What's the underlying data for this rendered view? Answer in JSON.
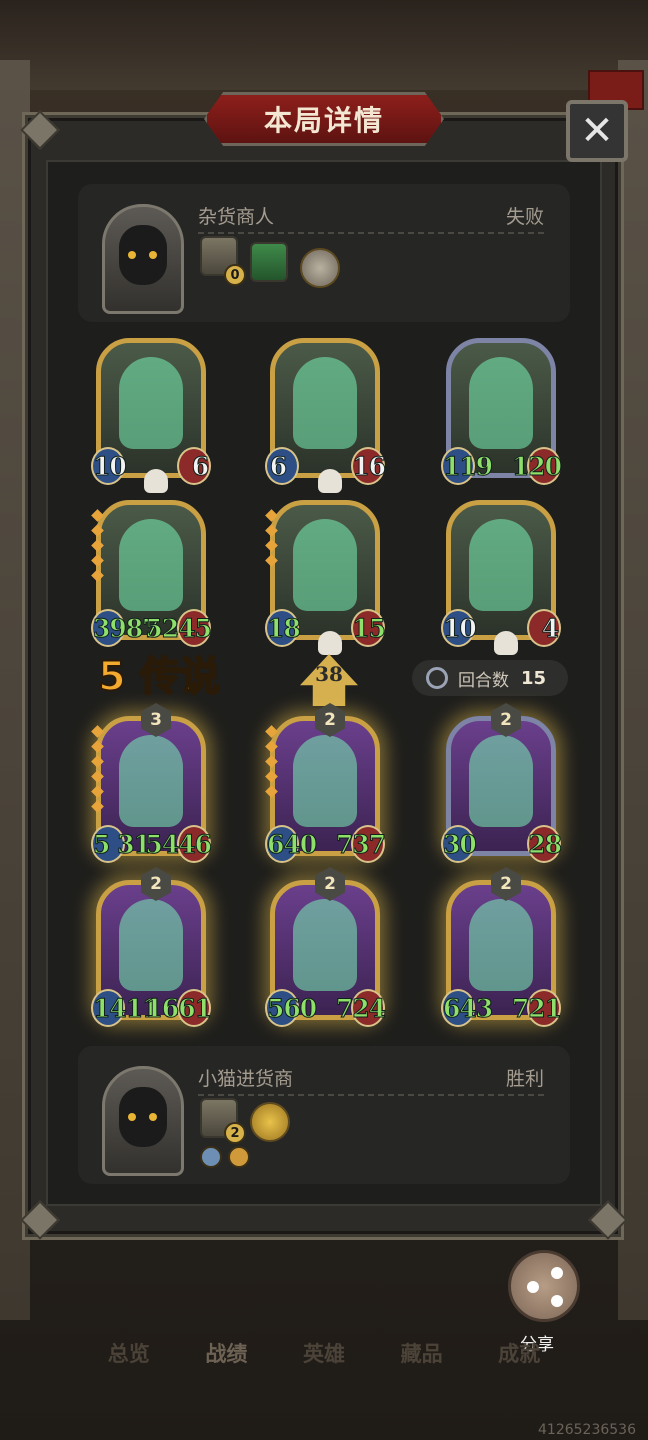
{
  "dialog": {
    "title": "本局详情",
    "close_label": "✕"
  },
  "opponent": {
    "name": "杂货商人",
    "result": "失败",
    "hero_level_badge": "0"
  },
  "player": {
    "name": "小猫进货商",
    "result": "胜利",
    "hero_level_badge": "2"
  },
  "opponent_board": [
    {
      "attack": "10",
      "health": "6",
      "style": "plain",
      "frame": "gold",
      "dead": true,
      "stars": 0
    },
    {
      "attack": "6",
      "health": "16",
      "style": "plain",
      "frame": "gold",
      "dead": true,
      "stars": 0
    },
    {
      "attack": "119",
      "health": "120",
      "style": "buff",
      "frame": "silver",
      "dead": false,
      "stars": 0
    },
    {
      "attack": "3987",
      "health": "5245",
      "style": "buff",
      "frame": "gold",
      "dead": false,
      "stars": 5
    },
    {
      "attack": "18",
      "health": "15",
      "style": "buff",
      "frame": "gold",
      "dead": true,
      "stars": 4
    },
    {
      "attack": "10",
      "health": "4",
      "style": "plain",
      "frame": "gold",
      "dead": true,
      "stars": 0
    }
  ],
  "player_board": [
    {
      "level": "3",
      "attack": "5 31",
      "health": "5446",
      "frame": "gold",
      "stars": 6
    },
    {
      "level": "2",
      "attack": "640",
      "health": "737",
      "frame": "gold",
      "stars": 5
    },
    {
      "level": "2",
      "attack": "30",
      "health": "28",
      "frame": "silver",
      "stars": 0
    },
    {
      "level": "2",
      "attack": "1411",
      "health": "1661",
      "frame": "gold",
      "stars": 0
    },
    {
      "level": "2",
      "attack": "560",
      "health": "724",
      "frame": "gold",
      "stars": 0
    },
    {
      "level": "2",
      "attack": "643",
      "health": "721",
      "frame": "gold",
      "stars": 0
    }
  ],
  "summary": {
    "legend_count": "5 传说",
    "level": "38",
    "turns_label": "回合数",
    "turns_value": "15"
  },
  "share_label": "分享",
  "bottom_tabs": [
    "总览",
    "战绩",
    "英雄",
    "藏品",
    "成就"
  ],
  "active_tab": "战绩",
  "watermark": "41265236536"
}
